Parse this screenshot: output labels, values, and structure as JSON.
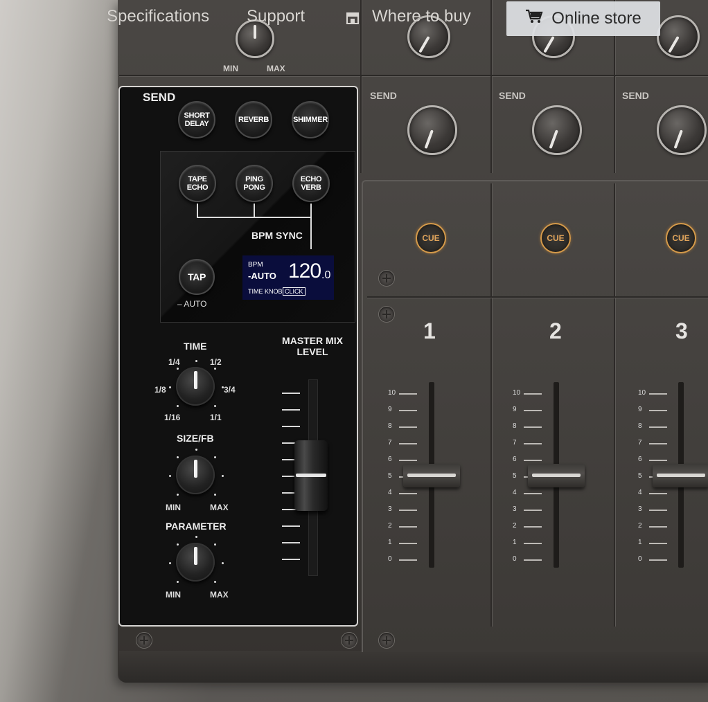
{
  "nav": {
    "specifications": "Specifications",
    "support": "Support",
    "where_to_buy": "Where to buy",
    "online_store": "Online store"
  },
  "top_knob": {
    "min": "MIN",
    "max": "MAX"
  },
  "send_label": "SEND",
  "fx": {
    "send_title": "SEND",
    "buttons_row1": [
      "SHORT\nDELAY",
      "REVERB",
      "SHIMMER"
    ],
    "buttons_row2": [
      "TAPE\nECHO",
      "PING\nPONG",
      "ECHO\nVERB"
    ],
    "bpm_sync": "BPM SYNC",
    "tap": "TAP",
    "tap_sub": "– AUTO",
    "lcd_bpm": "BPM",
    "lcd_auto": "-AUTO",
    "lcd_value": "120",
    "lcd_decimal": ".0",
    "lcd_time_knob": "TIME KNOB",
    "lcd_click": "CLICK",
    "time_label": "TIME",
    "time_ticks": [
      "1/4",
      "1/2",
      "1/8",
      "3/4",
      "1/16",
      "1/1"
    ],
    "size_label": "SIZE/FB",
    "param_label": "PARAMETER",
    "min": "MIN",
    "max": "MAX",
    "master_mix_label": "MASTER MIX\nLEVEL"
  },
  "channels": [
    {
      "number": "1",
      "cue": "CUE"
    },
    {
      "number": "2",
      "cue": "CUE"
    },
    {
      "number": "3",
      "cue": "CUE"
    }
  ],
  "fader_scale": [
    "10",
    "9",
    "8",
    "7",
    "6",
    "5",
    "4",
    "3",
    "2",
    "1",
    "0"
  ],
  "colors": {
    "cue_accent": "#d59a4a",
    "lcd_bg": "#0a0d3c"
  }
}
